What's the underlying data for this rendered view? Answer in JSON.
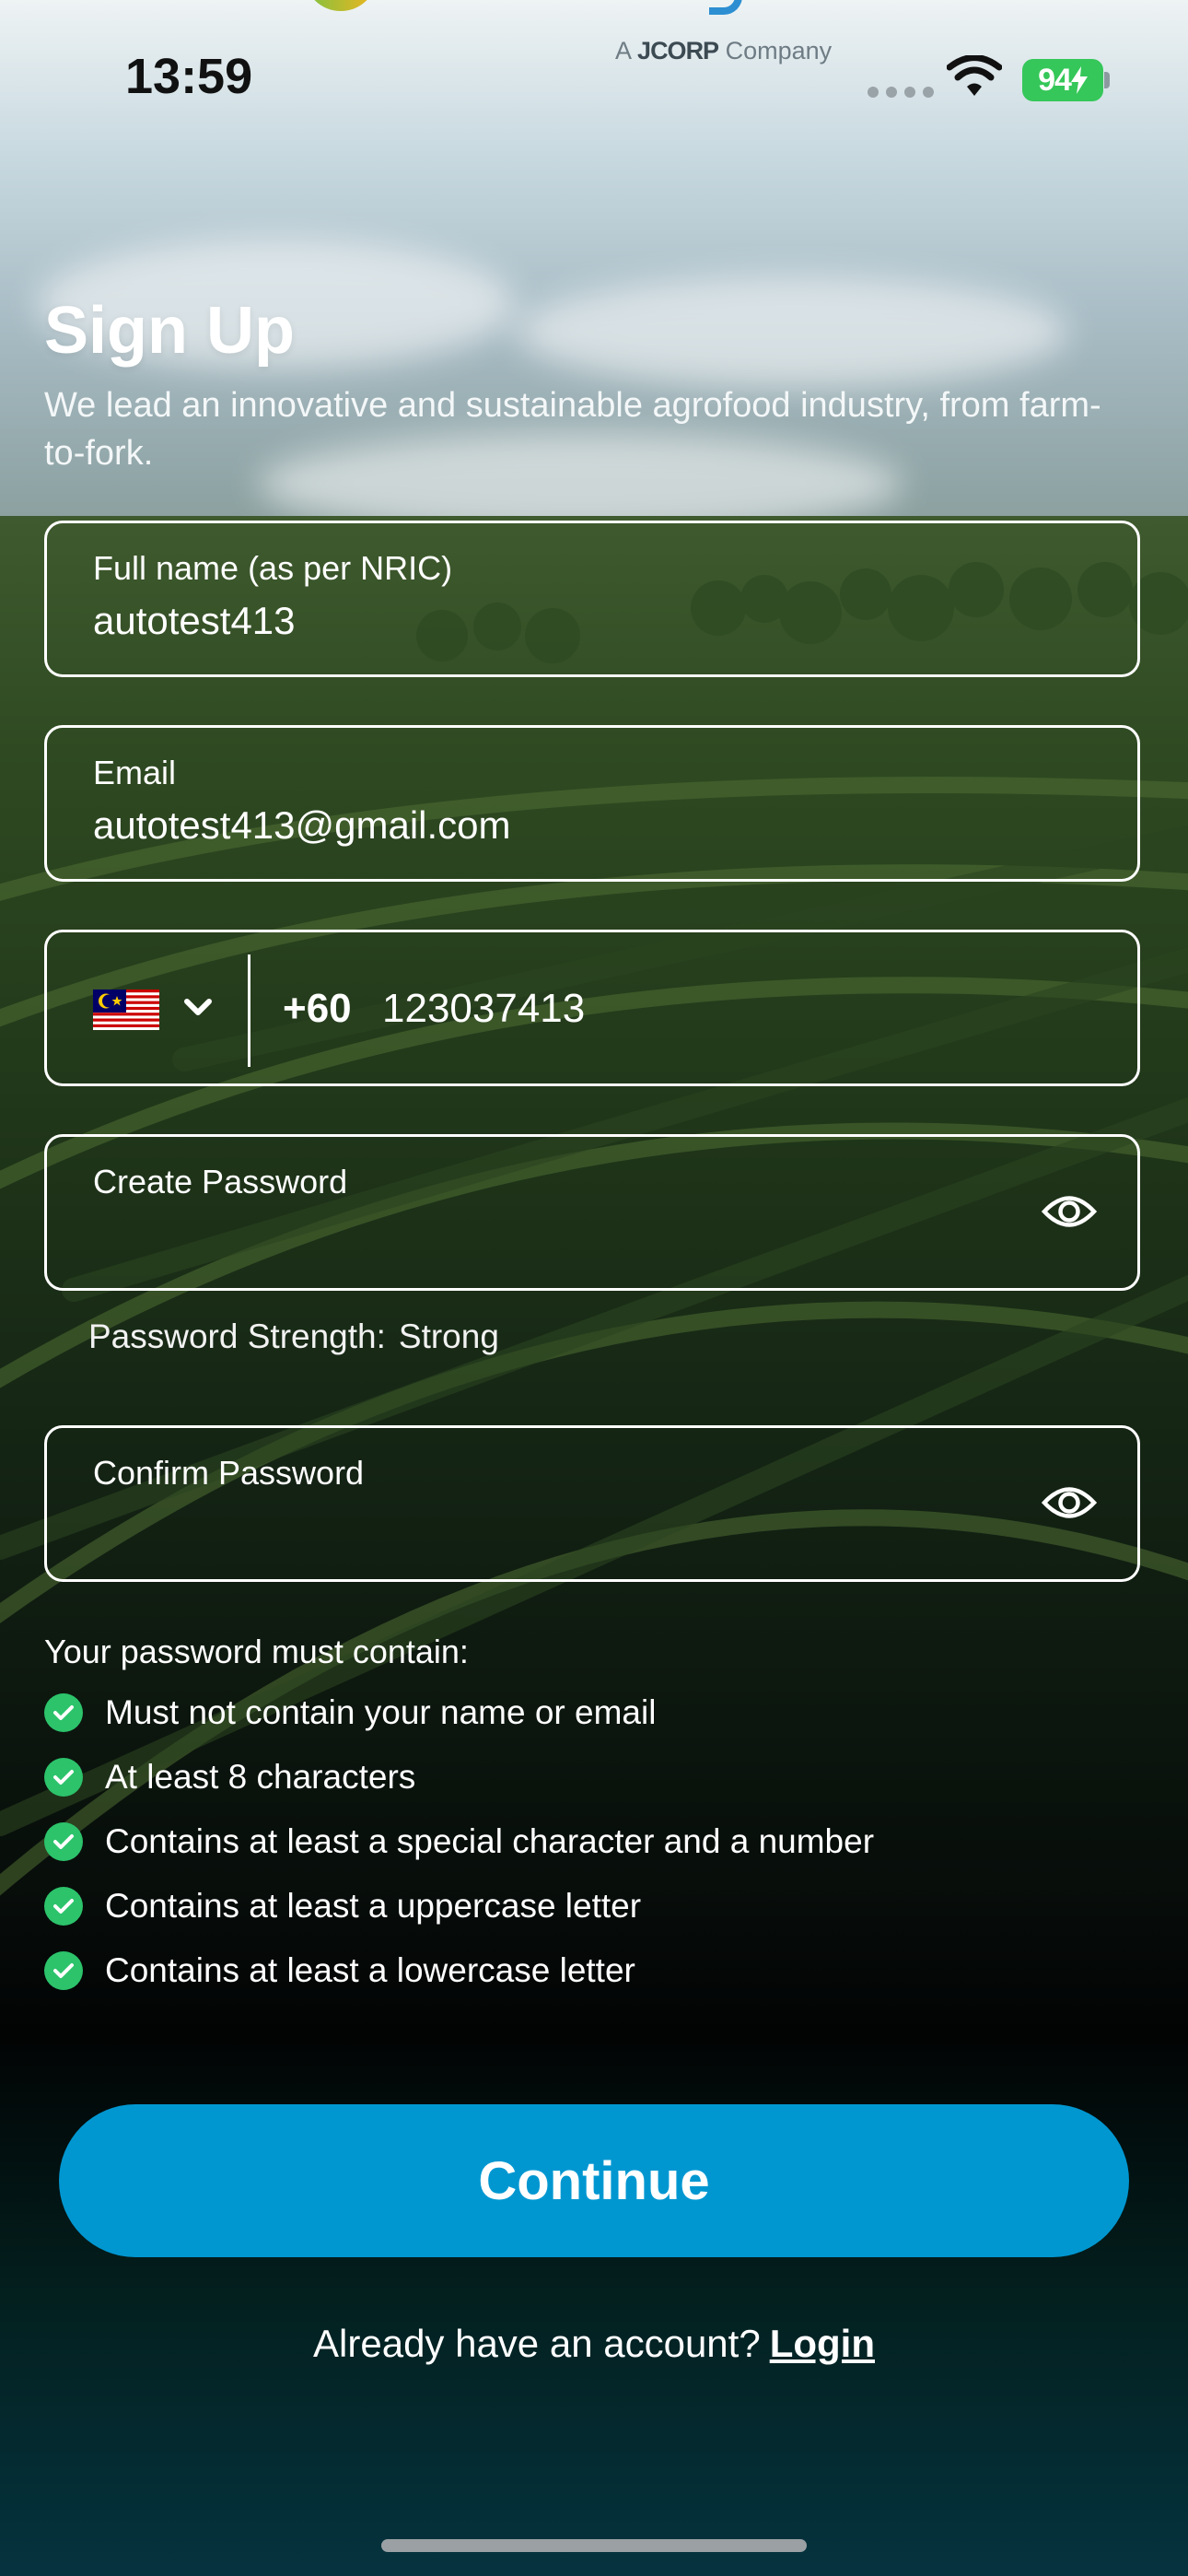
{
  "status_bar": {
    "time": "13:59",
    "battery": "94",
    "brand_tag_prefix": "A",
    "brand_tag_company": "JCORP",
    "brand_tag_suffix": "Company"
  },
  "header": {
    "title": "Sign Up",
    "subtitle": "We lead an innovative and sustainable agrofood industry, from farm-to-fork."
  },
  "form": {
    "full_name": {
      "label": "Full name (as per NRIC)",
      "value": "autotest413"
    },
    "email": {
      "label": "Email",
      "value": "autotest413@gmail.com"
    },
    "phone": {
      "country_flag": "malaysia-flag-icon",
      "code": "+60",
      "number": "123037413"
    },
    "create_password": {
      "label": "Create Password",
      "value": ""
    },
    "password_strength": {
      "label": "Password Strength:",
      "value": "Strong"
    },
    "confirm_password": {
      "label": "Confirm Password",
      "value": ""
    }
  },
  "requirements": {
    "title": "Your password must contain:",
    "items": [
      {
        "label": "Must not contain your name or email",
        "met": true
      },
      {
        "label": "At least 8 characters",
        "met": true
      },
      {
        "label": "Contains at least a special character and a number",
        "met": true
      },
      {
        "label": "Contains at least a uppercase letter",
        "met": true
      },
      {
        "label": "Contains at least a lowercase letter",
        "met": true
      }
    ]
  },
  "actions": {
    "continue_label": "Continue",
    "login_prompt": "Already have an account?",
    "login_label": "Login"
  },
  "colors": {
    "accent": "#0097d1",
    "check": "#2cc36b",
    "battery": "#35c759"
  }
}
